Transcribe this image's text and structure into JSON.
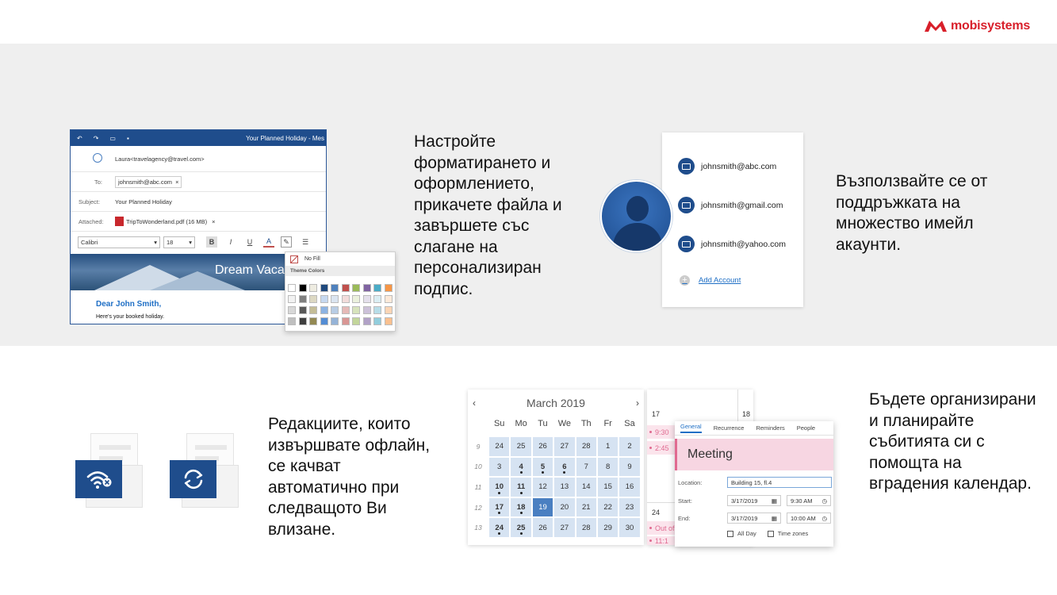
{
  "brand": {
    "name": "mobisystems",
    "color": "#d81f2a"
  },
  "features": {
    "formatting": "Настройте форматирането и оформлението, прикачете файла и завършете със слагане на персонализиран подпис.",
    "accounts": "Възползвайте се от поддръжката на множество имейл акаунти.",
    "offline": "Редакциите, които извършвате офлайн, се качват автоматично при следващото Ви влизане.",
    "calendar": "Бъдете организирани и планирайте събитията си с помощта на вградения календар."
  },
  "email": {
    "window_title": "Your Planned Holiday - Mes",
    "from": "Laura<travelagency@travel.com>",
    "to_label": "To:",
    "to": "johnsmith@abc.com",
    "subject_label": "Subject:",
    "subject": "Your Planned Holiday",
    "attached_label": "Attached:",
    "attachment": "TripToWonderland.pdf (16 MB)",
    "font": "Calibri",
    "size": "18",
    "bold": "B",
    "italic": "I",
    "underline": "U",
    "font_color": "A",
    "banner_text": "Dream Vaca",
    "greeting": "Dear John Smith,",
    "body": "Here's your booked holiday."
  },
  "palette": {
    "no_fill": "No Fill",
    "theme_colors": "Theme Colors",
    "rows": [
      [
        "#ffffff",
        "#000000",
        "#eeece1",
        "#1f497d",
        "#4f81bd",
        "#c0504d",
        "#9bbb59",
        "#8064a2",
        "#4bacc6",
        "#f79646"
      ],
      [
        "#f2f2f2",
        "#7f7f7f",
        "#ddd9c3",
        "#c6d9f0",
        "#dbe5f1",
        "#f2dcdb",
        "#ebf1dd",
        "#e5e0ec",
        "#dbeef3",
        "#fdeada"
      ],
      [
        "#d8d8d8",
        "#595959",
        "#c4bd97",
        "#8db3e2",
        "#b8cce4",
        "#e5b9b7",
        "#d7e3bc",
        "#ccc1d9",
        "#b7dde8",
        "#fbd5b5"
      ],
      [
        "#bfbfbf",
        "#3f3f3f",
        "#938953",
        "#548dd4",
        "#95b3d7",
        "#d99694",
        "#c3d69b",
        "#b2a2c7",
        "#92cddc",
        "#fac08f"
      ]
    ]
  },
  "accounts": {
    "list": [
      "johnsmith@abc.com",
      "johnsmith@gmail.com",
      "johnsmith@yahoo.com"
    ],
    "add": "Add Account"
  },
  "calendar": {
    "month": "March 2019",
    "weekdays": [
      "Su",
      "Mo",
      "Tu",
      "We",
      "Th",
      "Fr",
      "Sa"
    ],
    "weeks": [
      {
        "num": "9",
        "days": [
          "24",
          "25",
          "26",
          "27",
          "28",
          "1",
          "2"
        ]
      },
      {
        "num": "10",
        "days": [
          "3",
          "4",
          "5",
          "6",
          "7",
          "8",
          "9"
        ]
      },
      {
        "num": "11",
        "days": [
          "10",
          "11",
          "12",
          "13",
          "14",
          "15",
          "16"
        ]
      },
      {
        "num": "12",
        "days": [
          "17",
          "18",
          "19",
          "20",
          "21",
          "22",
          "23"
        ]
      },
      {
        "num": "13",
        "days": [
          "24",
          "25",
          "26",
          "27",
          "28",
          "29",
          "30"
        ]
      }
    ],
    "today": "19",
    "day_labels": [
      "17",
      "18",
      "24"
    ],
    "events": [
      "9:30",
      "2:45",
      "Out of",
      "11:1"
    ]
  },
  "event": {
    "tabs": [
      "General",
      "Recurrence",
      "Reminders",
      "People"
    ],
    "title": "Meeting",
    "location_label": "Location:",
    "location": "Building 15, fl.4",
    "start_label": "Start:",
    "start_date": "3/17/2019",
    "start_time": "9:30 AM",
    "end_label": "End:",
    "end_date": "3/17/2019",
    "end_time": "10:00 AM",
    "all_day": "All Day",
    "time_zones": "Time zones"
  }
}
